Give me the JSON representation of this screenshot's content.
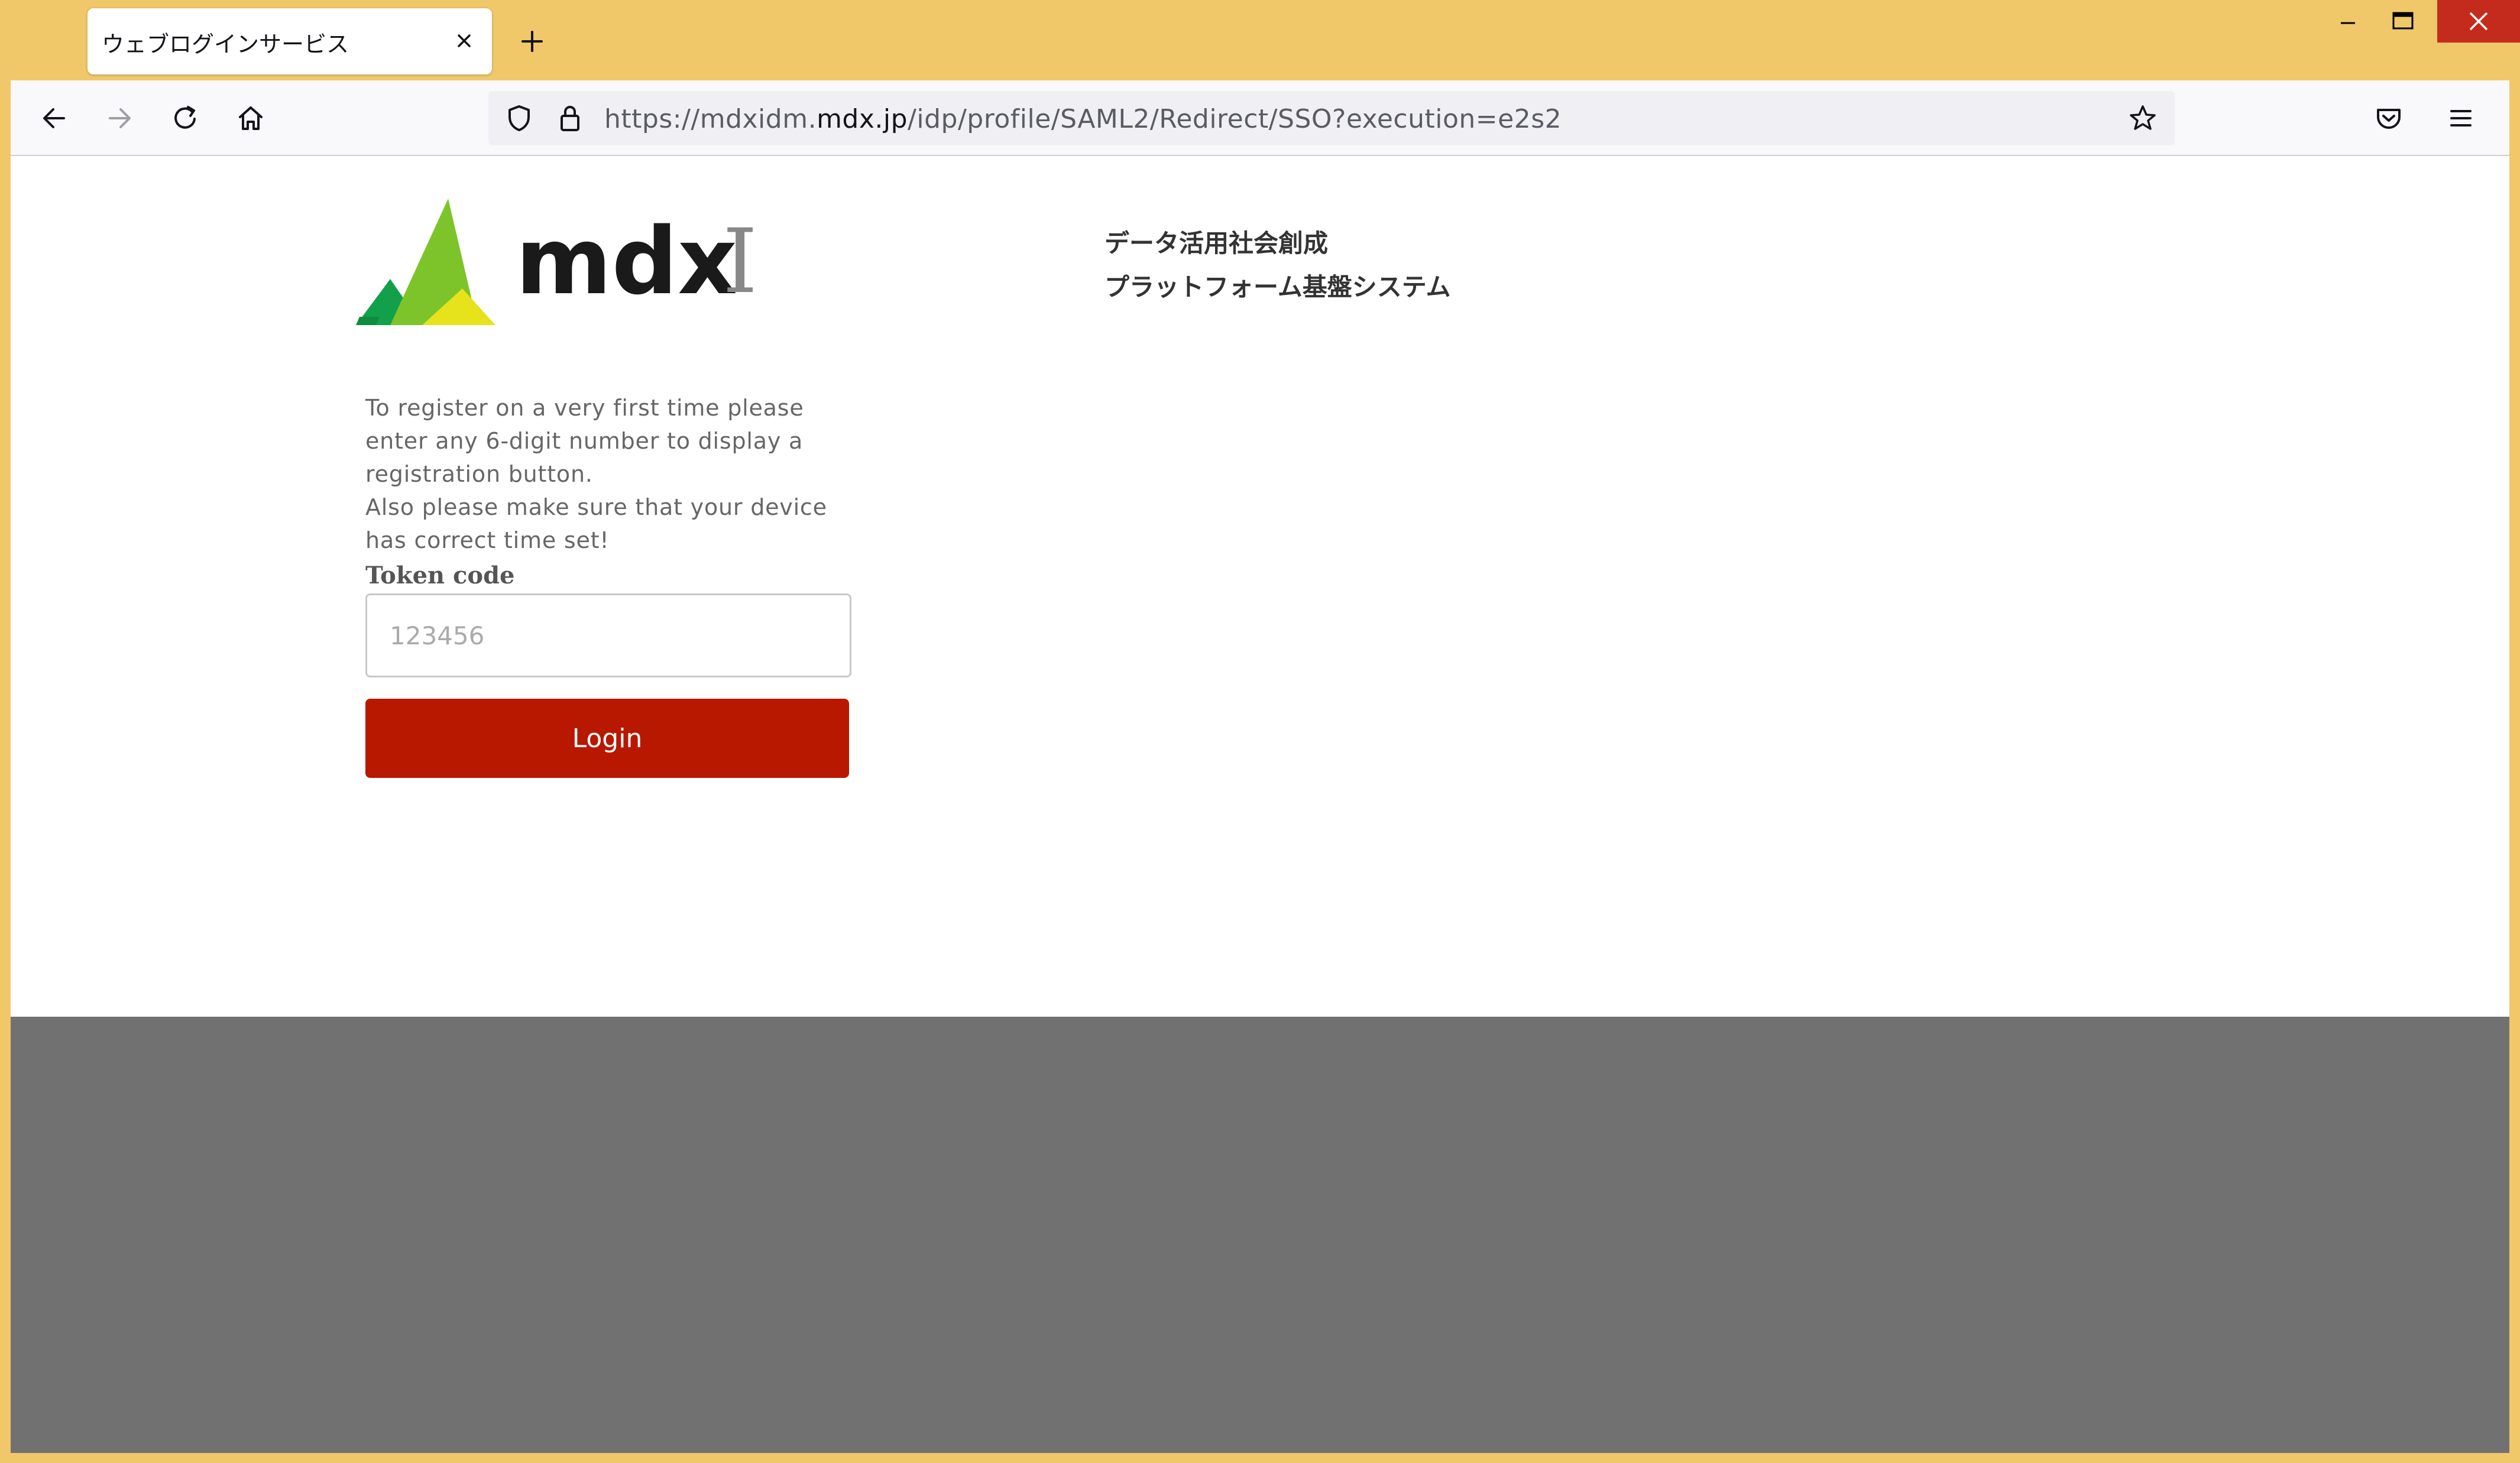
{
  "browser": {
    "tab_title": "ウェブログインサービス",
    "url_prefix": "https://mdxidm.",
    "url_domain": "mdx.jp",
    "url_path": "/idp/profile/SAML2/Redirect/SSO?execution=e2s2"
  },
  "logo": {
    "wordmark": "mdx",
    "separator": "I",
    "tagline_line1": "データ活用社会創成",
    "tagline_line2": "プラットフォーム基盤システム"
  },
  "form": {
    "instruction_line1": "To register on a very first time please enter any 6-digit number to display a registration button.",
    "instruction_line2": "Also please make sure that your device has correct time set!",
    "token_label": "Token code",
    "token_placeholder": "123456",
    "token_value": "",
    "login_label": "Login"
  },
  "colors": {
    "window_frame": "#F0C86A",
    "login_button": "#B81800",
    "footer_band": "#717171",
    "close_button": "#C42B1C"
  }
}
